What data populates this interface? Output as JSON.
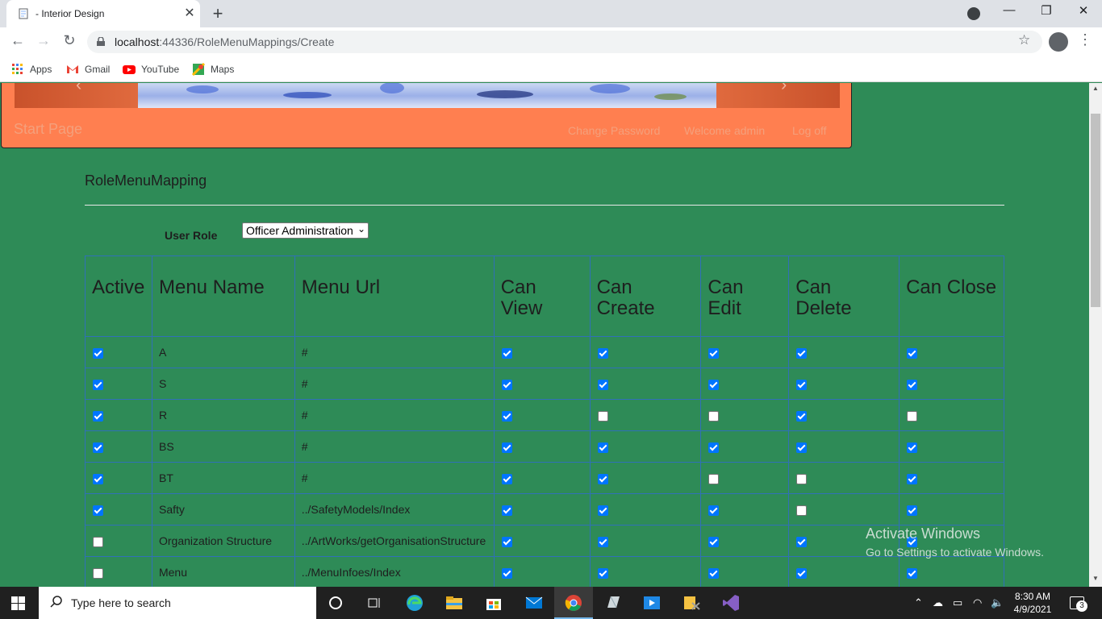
{
  "browser": {
    "tab_title": "- Interior Design",
    "url_host": "localhost",
    "url_path": ":44336/RoleMenuMappings/Create",
    "bookmarks": [
      "Apps",
      "Gmail",
      "YouTube",
      "Maps"
    ]
  },
  "header": {
    "brand": "Start Page",
    "links": [
      "Change Password",
      "Welcome admin",
      "Log off"
    ]
  },
  "page": {
    "title": "RoleMenuMapping",
    "role_label": "User Role",
    "role_value": "Officer Administration",
    "columns": [
      "Active",
      "Menu Name",
      "Menu Url",
      "Can View",
      "Can Create",
      "Can Edit",
      "Can Delete",
      "Can Close"
    ],
    "rows": [
      {
        "active": true,
        "name": "A",
        "url": "#",
        "view": true,
        "create": true,
        "edit": true,
        "delete": true,
        "close": true
      },
      {
        "active": true,
        "name": "S",
        "url": "#",
        "view": true,
        "create": true,
        "edit": true,
        "delete": true,
        "close": true
      },
      {
        "active": true,
        "name": "R",
        "url": "#",
        "view": true,
        "create": false,
        "edit": false,
        "delete": true,
        "close": false
      },
      {
        "active": true,
        "name": "BS",
        "url": "#",
        "view": true,
        "create": true,
        "edit": true,
        "delete": true,
        "close": true
      },
      {
        "active": true,
        "name": "BT",
        "url": "#",
        "view": true,
        "create": true,
        "edit": false,
        "delete": false,
        "close": true
      },
      {
        "active": true,
        "name": "Safty",
        "url": "../SafetyModels/Index",
        "view": true,
        "create": true,
        "edit": true,
        "delete": false,
        "close": true
      },
      {
        "active": false,
        "name": "Organization Structure",
        "url": "../ArtWorks/getOrganisationStructure",
        "view": true,
        "create": true,
        "edit": true,
        "delete": true,
        "close": true
      },
      {
        "active": false,
        "name": "Menu",
        "url": "../MenuInfoes/Index",
        "view": true,
        "create": true,
        "edit": true,
        "delete": true,
        "close": true
      }
    ]
  },
  "watermark": {
    "line1": "Activate Windows",
    "line2": "Go to Settings to activate Windows."
  },
  "taskbar": {
    "search_placeholder": "Type here to search",
    "time": "8:30 AM",
    "date": "4/9/2021",
    "notification_count": "3"
  }
}
